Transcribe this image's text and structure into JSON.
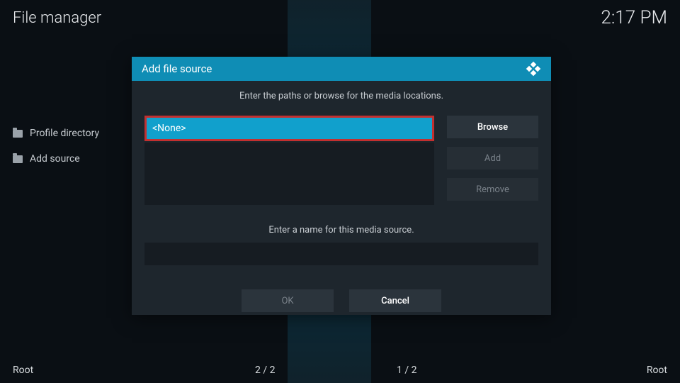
{
  "header": {
    "title": "File manager",
    "time": "2:17 PM"
  },
  "sidebar": {
    "items": [
      {
        "label": "Profile directory"
      },
      {
        "label": "Add source"
      }
    ]
  },
  "dialog": {
    "title": "Add file source",
    "prompt_paths": "Enter the paths or browse for the media locations.",
    "path_value": "<None>",
    "browse_label": "Browse",
    "add_label": "Add",
    "remove_label": "Remove",
    "prompt_name": "Enter a name for this media source.",
    "name_value": "",
    "ok_label": "OK",
    "cancel_label": "Cancel"
  },
  "status": {
    "left_label": "Root",
    "left_count": "2 / 2",
    "right_count": "1 / 2",
    "right_label": "Root"
  }
}
